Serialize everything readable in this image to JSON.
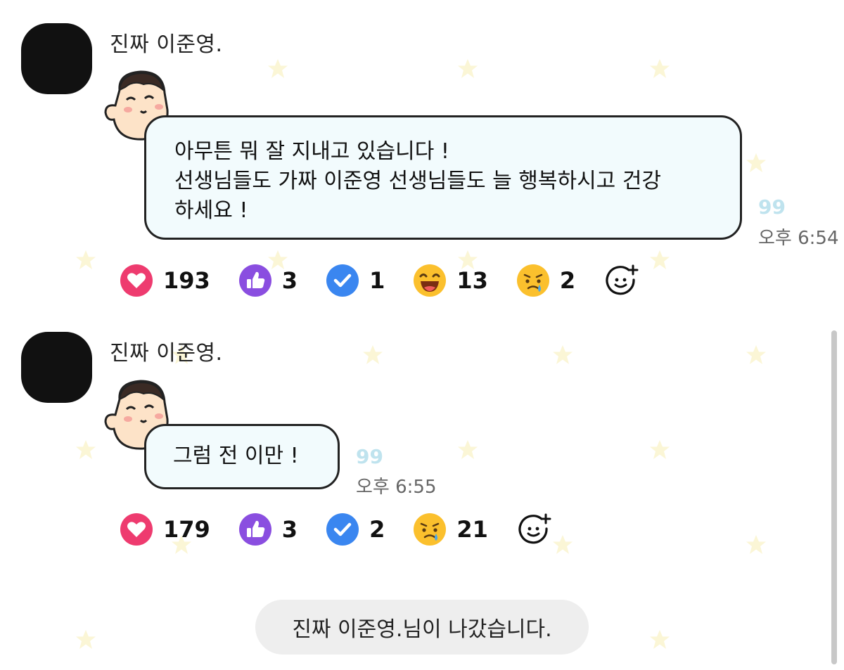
{
  "colors": {
    "background": "#ffffff",
    "bubble_fill": "#f2fbfd",
    "bubble_border": "#222222",
    "unread": "#bfe3ee",
    "heart": "#ee3b6f",
    "thumbs": "#8a4ee0",
    "check": "#3a86f0",
    "system_bg": "#eeeeee"
  },
  "messages": [
    {
      "sender": "진짜 이준영.",
      "lines": [
        "아무튼 뭐 잘 지내고 있습니다 !",
        "선생님들도 가짜 이준영 선생님들도 늘 행복하시고 건강",
        "하세요 !"
      ],
      "unread": "99",
      "time": "오후 6:54",
      "reactions": [
        {
          "icon": "heart-icon",
          "count": "193"
        },
        {
          "icon": "thumbs-up-icon",
          "count": "3"
        },
        {
          "icon": "check-icon",
          "count": "1"
        },
        {
          "icon": "laughing-emoji-icon",
          "count": "13"
        },
        {
          "icon": "sad-emoji-icon",
          "count": "2"
        }
      ]
    },
    {
      "sender": "진짜 이준영.",
      "lines": [
        "그럼 전 이만 !"
      ],
      "unread": "99",
      "time": "오후 6:55",
      "reactions": [
        {
          "icon": "heart-icon",
          "count": "179"
        },
        {
          "icon": "thumbs-up-icon",
          "count": "3"
        },
        {
          "icon": "check-icon",
          "count": "2"
        },
        {
          "icon": "sad-emoji-icon",
          "count": "21"
        }
      ]
    }
  ],
  "system_notice": "진짜 이준영.님이 나갔습니다."
}
